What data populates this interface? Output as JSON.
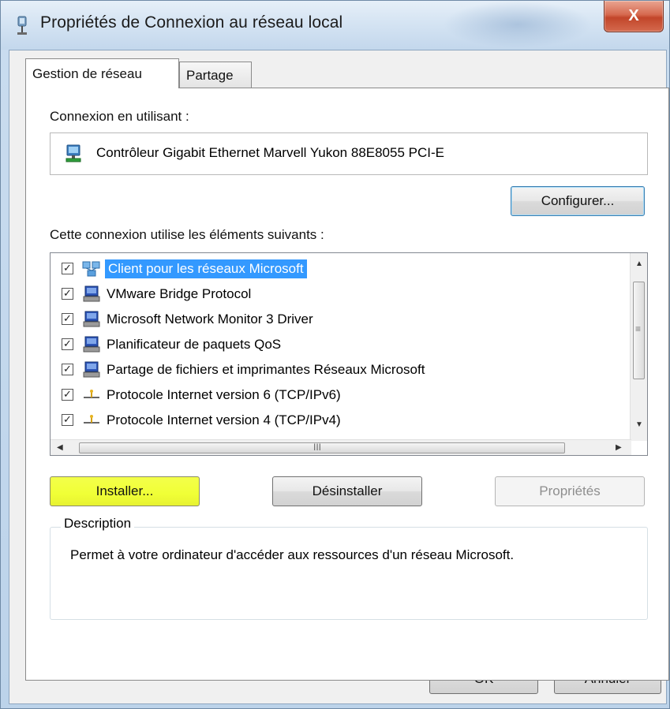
{
  "window": {
    "title": "Propriétés de Connexion au réseau local",
    "close_label": "X"
  },
  "tabs": [
    {
      "label": "Gestion de réseau",
      "active": true
    },
    {
      "label": "Partage",
      "active": false
    }
  ],
  "connection": {
    "label": "Connexion en utilisant :",
    "adapter": "Contrôleur Gigabit Ethernet Marvell Yukon 88E8055 PCI-E",
    "configure_label": "Configurer..."
  },
  "components": {
    "label": "Cette connexion utilise les éléments suivants :",
    "items": [
      {
        "label": "Client pour les réseaux Microsoft",
        "checked": true,
        "selected": true,
        "icon": "network-client-icon"
      },
      {
        "label": "VMware Bridge Protocol",
        "checked": true,
        "selected": false,
        "icon": "network-service-icon"
      },
      {
        "label": "Microsoft Network Monitor 3 Driver",
        "checked": true,
        "selected": false,
        "icon": "network-service-icon"
      },
      {
        "label": "Planificateur de paquets QoS",
        "checked": true,
        "selected": false,
        "icon": "network-service-icon"
      },
      {
        "label": "Partage de fichiers et imprimantes Réseaux Microsoft",
        "checked": true,
        "selected": false,
        "icon": "network-service-icon"
      },
      {
        "label": "Protocole Internet version 6 (TCP/IPv6)",
        "checked": true,
        "selected": false,
        "icon": "protocol-icon"
      },
      {
        "label": "Protocole Internet version 4 (TCP/IPv4)",
        "checked": true,
        "selected": false,
        "icon": "protocol-icon"
      }
    ],
    "scroll_thumb_label": "III",
    "vscroll_grip_label": "≡"
  },
  "buttons": {
    "install": "Installer...",
    "uninstall": "Désinstaller",
    "properties": "Propriétés",
    "ok": "OK",
    "cancel": "Annuler"
  },
  "description": {
    "legend": "Description",
    "text": "Permet à votre ordinateur d'accéder aux ressources d'un réseau Microsoft."
  },
  "colors": {
    "selection": "#3399ff",
    "install_highlight": "#f0ff36",
    "close_button": "#c7462b"
  }
}
